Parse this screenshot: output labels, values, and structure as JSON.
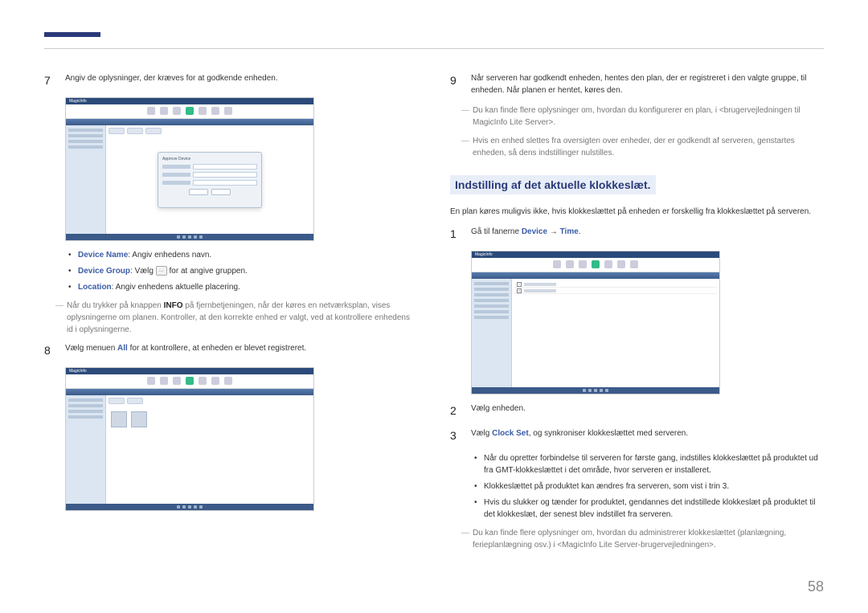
{
  "page_number": "58",
  "left": {
    "step7": {
      "num": "7",
      "text": "Angiv de oplysninger, der kræves for at godkende enheden."
    },
    "screenshot1": {
      "logo": "MagicInfo",
      "dialog_title": "Approve Device"
    },
    "bullets": {
      "b1_label": "Device Name",
      "b1_rest": ": Angiv enhedens navn.",
      "b2_label": "Device Group",
      "b2_mid": ": Vælg",
      "b2_rest": " for at angive gruppen.",
      "b3_label": "Location",
      "b3_rest": ": Angiv enhedens aktuelle placering."
    },
    "note1_a": "Når du trykker på knappen ",
    "note1_info": "INFO",
    "note1_b": " på fjernbetjeningen, når der køres en netværksplan, vises oplysningerne om planen. Kontroller, at den korrekte enhed er valgt, ved at kontrollere enhedens id i oplysningerne.",
    "step8": {
      "num": "8",
      "text_a": "Vælg menuen ",
      "text_all": "All",
      "text_b": " for at kontrollere, at enheden er blevet registreret."
    },
    "icon_ellipsis": "..."
  },
  "right": {
    "step9": {
      "num": "9",
      "text": "Når serveren har godkendt enheden, hentes den plan, der er registreret i den valgte gruppe, til enheden. Når planen er hentet, køres den."
    },
    "note_r1": "Du kan finde flere oplysninger om, hvordan du konfigurerer en plan, i <brugervejledningen til MagicInfo Lite Server>.",
    "note_r2": "Hvis en enhed slettes fra oversigten over enheder, der er godkendt af serveren, genstartes enheden, så dens indstillinger nulstilles.",
    "heading": "Indstilling af det aktuelle klokkeslæt.",
    "para1": "En plan køres muligvis ikke, hvis klokkeslættet på enheden er forskellig fra klokkeslættet på serveren.",
    "step1": {
      "num": "1",
      "text_a": "Gå til fanerne ",
      "device": "Device",
      "arrow": " → ",
      "time": "Time",
      "dot": "."
    },
    "step2": {
      "num": "2",
      "text": "Vælg enheden."
    },
    "step3": {
      "num": "3",
      "text_a": "Vælg ",
      "clockset": "Clock Set",
      "text_b": ", og synkroniser klokkeslættet med serveren."
    },
    "bullets2": {
      "b1": "Når du opretter forbindelse til serveren for første gang, indstilles klokkeslættet på produktet ud fra GMT-klokkeslættet i det område, hvor serveren er installeret.",
      "b2": "Klokkeslættet på produktet kan ændres fra serveren, som vist i trin 3.",
      "b3": "Hvis du slukker og tænder for produktet, gendannes det indstillede klokkeslæt på produktet til det klokkeslæt, der senest blev indstillet fra serveren."
    },
    "note_r3": "Du kan finde flere oplysninger om, hvordan du administrerer klokkeslættet (planlægning, ferieplanlægning osv.) i <MagicInfo Lite Server-brugervejledningen>."
  }
}
